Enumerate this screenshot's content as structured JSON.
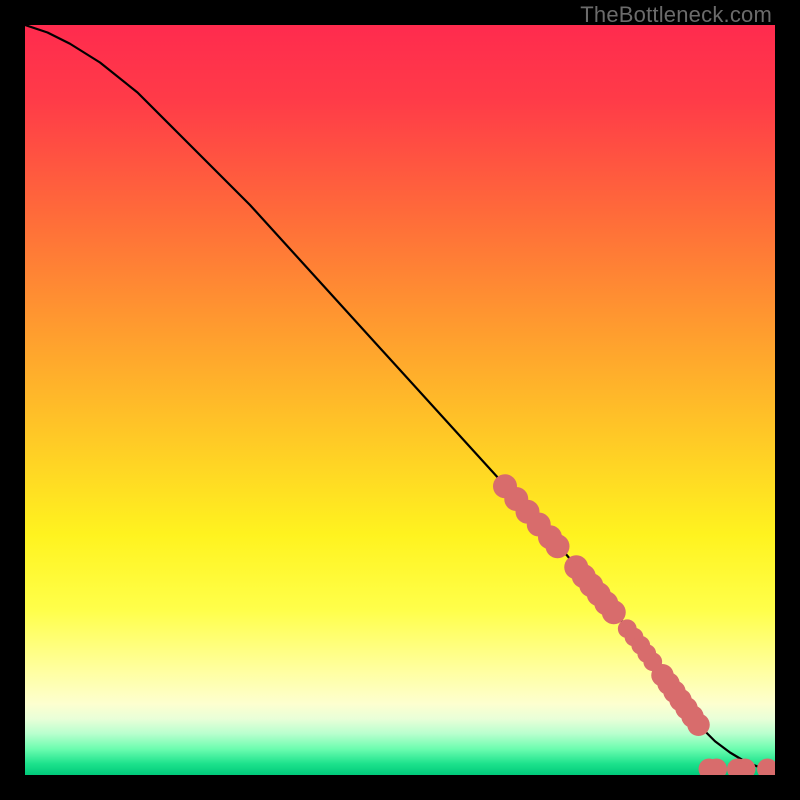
{
  "watermark": "TheBottleneck.com",
  "chart_data": {
    "type": "line",
    "title": "",
    "xlabel": "",
    "ylabel": "",
    "xlim": [
      0,
      100
    ],
    "ylim": [
      0,
      100
    ],
    "grid": false,
    "series": [
      {
        "name": "curve",
        "x": [
          0,
          3,
          6,
          10,
          15,
          20,
          30,
          40,
          50,
          60,
          70,
          80,
          85,
          88,
          90,
          92,
          94,
          96,
          98,
          100
        ],
        "y": [
          100,
          99,
          97.5,
          95,
          91,
          86,
          76,
          65,
          54,
          43,
          32,
          20,
          13,
          9,
          6.5,
          4.5,
          3,
          1.8,
          1,
          0.7
        ]
      }
    ],
    "markers": {
      "name": "highlighted-points",
      "color": "#d86c6c",
      "points": [
        {
          "x": 64,
          "y": 38.5,
          "r": 1.6
        },
        {
          "x": 65.5,
          "y": 36.8,
          "r": 1.6
        },
        {
          "x": 67,
          "y": 35.1,
          "r": 1.6
        },
        {
          "x": 68.5,
          "y": 33.4,
          "r": 1.6
        },
        {
          "x": 70,
          "y": 31.7,
          "r": 1.6
        },
        {
          "x": 71,
          "y": 30.5,
          "r": 1.6
        },
        {
          "x": 73.5,
          "y": 27.7,
          "r": 1.6
        },
        {
          "x": 74.5,
          "y": 26.5,
          "r": 1.6
        },
        {
          "x": 75.5,
          "y": 25.3,
          "r": 1.6
        },
        {
          "x": 76.5,
          "y": 24.1,
          "r": 1.6
        },
        {
          "x": 77.5,
          "y": 22.9,
          "r": 1.6
        },
        {
          "x": 78.5,
          "y": 21.7,
          "r": 1.6
        },
        {
          "x": 80.3,
          "y": 19.5,
          "r": 1.25
        },
        {
          "x": 81.2,
          "y": 18.4,
          "r": 1.25
        },
        {
          "x": 82.1,
          "y": 17.3,
          "r": 1.25
        },
        {
          "x": 82.9,
          "y": 16.2,
          "r": 1.25
        },
        {
          "x": 83.7,
          "y": 15.1,
          "r": 1.25
        },
        {
          "x": 85,
          "y": 13.3,
          "r": 1.5
        },
        {
          "x": 85.8,
          "y": 12.2,
          "r": 1.5
        },
        {
          "x": 86.6,
          "y": 11.1,
          "r": 1.5
        },
        {
          "x": 87.4,
          "y": 10,
          "r": 1.5
        },
        {
          "x": 88.2,
          "y": 8.9,
          "r": 1.5
        },
        {
          "x": 89,
          "y": 7.8,
          "r": 1.5
        },
        {
          "x": 89.8,
          "y": 6.7,
          "r": 1.5
        },
        {
          "x": 91.2,
          "y": 0.8,
          "r": 1.4
        },
        {
          "x": 92.2,
          "y": 0.8,
          "r": 1.4
        },
        {
          "x": 95.0,
          "y": 0.8,
          "r": 1.4
        },
        {
          "x": 96.0,
          "y": 0.8,
          "r": 1.4
        },
        {
          "x": 99.0,
          "y": 0.8,
          "r": 1.4
        }
      ]
    },
    "background_gradient": [
      {
        "offset": 0.0,
        "color": "#ff2b4e"
      },
      {
        "offset": 0.1,
        "color": "#ff3b48"
      },
      {
        "offset": 0.25,
        "color": "#ff6a3a"
      },
      {
        "offset": 0.4,
        "color": "#ff9a2f"
      },
      {
        "offset": 0.55,
        "color": "#ffc926"
      },
      {
        "offset": 0.68,
        "color": "#fff31f"
      },
      {
        "offset": 0.78,
        "color": "#ffff4a"
      },
      {
        "offset": 0.86,
        "color": "#ffff9f"
      },
      {
        "offset": 0.905,
        "color": "#fdffcf"
      },
      {
        "offset": 0.925,
        "color": "#e9ffd8"
      },
      {
        "offset": 0.945,
        "color": "#b8ffce"
      },
      {
        "offset": 0.965,
        "color": "#6dfdb0"
      },
      {
        "offset": 0.985,
        "color": "#1de28c"
      },
      {
        "offset": 1.0,
        "color": "#00c97a"
      }
    ]
  }
}
